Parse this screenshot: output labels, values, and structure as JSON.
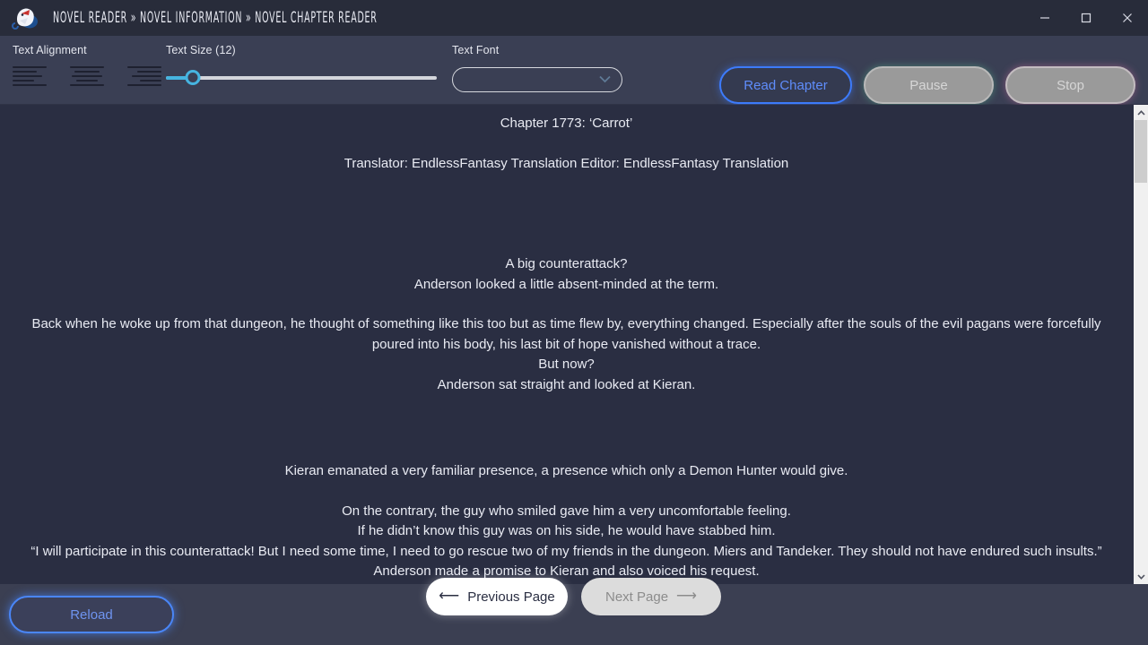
{
  "window": {
    "breadcrumb": "NOVEL READER » NOVEL INFORMATION » NOVEL CHAPTER READER",
    "logo_name": "app-logo",
    "minimize_label": "—",
    "maximize_label": "□",
    "close_label": "✕"
  },
  "toolbar": {
    "alignment": {
      "label": "Text Alignment",
      "options": [
        "align-left",
        "align-center",
        "align-right"
      ]
    },
    "text_size": {
      "label": "Text Size (12)",
      "value": 12,
      "min": 8,
      "max": 48,
      "percent": 10,
      "accent": "#46b4e0"
    },
    "text_font": {
      "label": "Text Font",
      "value": "",
      "placeholder": ""
    },
    "buttons": {
      "read": "Read Chapter",
      "pause": "Pause",
      "stop": "Stop"
    },
    "colors": {
      "read_accent": "#3d7bfb",
      "pause_glow": "#5ac896",
      "stop_glow": "#de78aa",
      "toolbar_bg": "#3a3f54"
    }
  },
  "reader": {
    "chapter_title": "Chapter 1773: ‘Carrot’",
    "credits": "Translator: EndlessFantasy Translation  Editor: EndlessFantasy Translation",
    "paragraphs": [
      "A big counterattack?",
      "Anderson looked a little absent-minded at the term.",
      "Back when he woke up from that dungeon, he thought of something like this too but as time flew by, everything changed. Especially after the souls of the evil pagans were forcefully poured into his body, his last bit of hope vanished without a trace.",
      "But now?",
      "Anderson sat straight and looked at Kieran.",
      "Kieran emanated a very familiar presence, a presence which only a Demon Hunter would give.",
      "On the contrary, the guy who smiled gave him a very uncomfortable feeling.",
      "If he didn’t know this guy was on his side, he would have stabbed him.",
      "“I will participate in this counterattack! But I need some time, I need to go rescue two of my friends in the dungeon. Miers and Tandeker. They should not have endured such insults.”",
      "Anderson made a promise to Kieran and also voiced his request."
    ],
    "background": "#2a2e42",
    "text_color": "#e9ebf3"
  },
  "scrollbar": {
    "up_arrow": "⌃",
    "down_arrow": "⌄",
    "thumb_top_percent": 0,
    "thumb_size_percent": 14
  },
  "footer": {
    "reload": "Reload",
    "previous": "Previous Page",
    "next": "Next Page",
    "previous_arrow": "⟵",
    "next_arrow": "⟶"
  }
}
